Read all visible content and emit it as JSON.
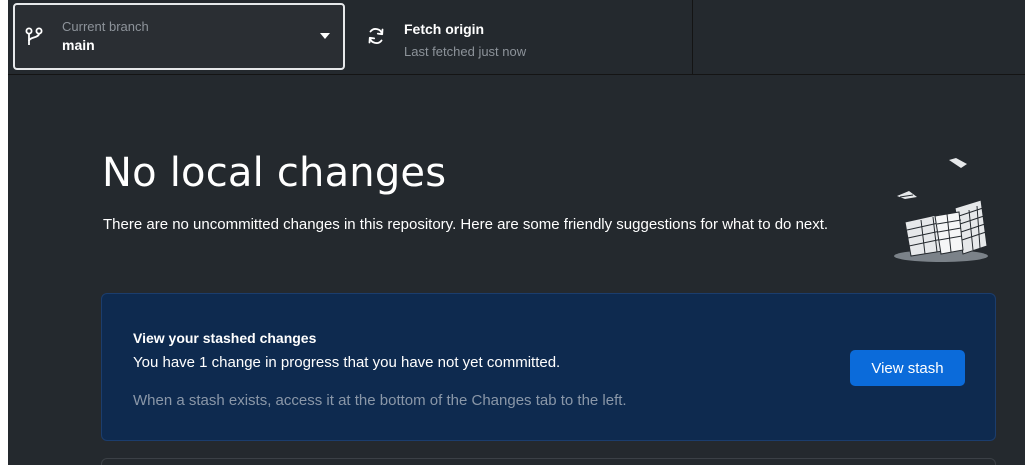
{
  "toolbar": {
    "branch": {
      "title": "Current branch",
      "value": "main",
      "icon": "git-branch-icon"
    },
    "fetch": {
      "title": "Fetch origin",
      "subtitle": "Last fetched just now",
      "icon": "sync-icon"
    }
  },
  "main": {
    "title": "No local changes",
    "description": "There are no uncommitted changes in this repository. Here are some friendly suggestions for what to do next.",
    "illustration": "paper-stack-illustration",
    "stash_card": {
      "title": "View your stashed changes",
      "description": "You have 1 change in progress that you have not yet committed.",
      "hint": "When a stash exists, access it at the bottom of the Changes tab to the left.",
      "button_label": "View stash"
    }
  },
  "colors": {
    "background": "#24292e",
    "card_background": "#0e2a4f",
    "accent": "#0b6bda",
    "text_primary": "#ffffff",
    "text_muted": "#8d939a"
  }
}
